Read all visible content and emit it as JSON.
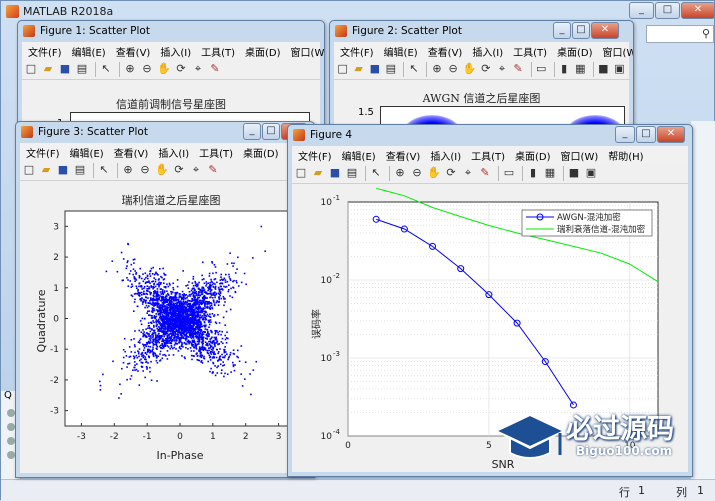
{
  "matlab": {
    "title": "MATLAB R2018a",
    "status_row_label": "行",
    "status_row_value": "1",
    "status_col_label": "列",
    "status_col_value": "1",
    "left_marker": "Q"
  },
  "menus": [
    "文件(F)",
    "编辑(E)",
    "查看(V)",
    "插入(I)",
    "工具(T)",
    "桌面(D)",
    "窗口(W)",
    "帮助(H)"
  ],
  "fig1": {
    "title": "Figure 1: Scatter Plot",
    "axes_title": "信道前调制信号星座图",
    "ytick_visible": "1"
  },
  "fig2": {
    "title": "Figure 2: Scatter Plot",
    "axes_title": "AWGN 信道之后星座图",
    "ytick_visible": "1.5"
  },
  "fig3": {
    "title": "Figure 3: Scatter Plot",
    "axes_title": "瑞利信道之后星座图",
    "xlabel": "In-Phase",
    "ylabel": "Quadrature"
  },
  "fig4": {
    "title": "Figure 4",
    "xlabel": "SNR",
    "ylabel": "误码率"
  },
  "chart_data": [
    {
      "type": "scatter",
      "title": "瑞利信道之后星座图",
      "xlabel": "In-Phase",
      "ylabel": "Quadrature",
      "xlim": [
        -3.5,
        3.5
      ],
      "ylim": [
        -3.5,
        3.5
      ],
      "xticks": [
        "-3",
        "-2",
        "-1",
        "0",
        "1",
        "2",
        "3"
      ],
      "yticks": [
        "3",
        "2",
        "1",
        "0",
        "-1",
        "-2",
        "-3"
      ],
      "clusters": [
        {
          "center": [
            0.7,
            0.7
          ],
          "spread": 0.55
        },
        {
          "center": [
            -0.7,
            0.7
          ],
          "spread": 0.55
        },
        {
          "center": [
            -0.7,
            -0.7
          ],
          "spread": 0.55
        },
        {
          "center": [
            0.7,
            -0.7
          ],
          "spread": 0.55
        }
      ],
      "color": "#0000ff"
    },
    {
      "type": "line",
      "xlabel": "SNR",
      "ylabel": "误码率",
      "y_scale": "log",
      "xlim": [
        0,
        11
      ],
      "ylim": [
        0.0001,
        0.1
      ],
      "xticks": [
        "0",
        "5",
        "10"
      ],
      "yticks": [
        "10^-1",
        "10^-2",
        "10^-3",
        "10^-4"
      ],
      "legend_position": "top-right",
      "grid": true,
      "series": [
        {
          "name": "AWGN-混沌加密",
          "color": "#0000ff",
          "marker": "circle",
          "x": [
            1,
            2,
            3,
            4,
            5,
            6,
            7,
            8
          ],
          "y": [
            0.06,
            0.045,
            0.027,
            0.014,
            0.0065,
            0.0028,
            0.0009,
            0.00025
          ]
        },
        {
          "name": "瑞利衰落信道-混沌加密",
          "color": "#00ee00",
          "marker": "none",
          "x": [
            1,
            2,
            3,
            4,
            5,
            6,
            7,
            8,
            9,
            10,
            11
          ],
          "y": [
            0.15,
            0.12,
            0.085,
            0.065,
            0.05,
            0.04,
            0.033,
            0.027,
            0.022,
            0.016,
            0.0095
          ]
        }
      ]
    }
  ],
  "watermark": {
    "cn": "必过源码",
    "en": "Biguo100.com"
  }
}
